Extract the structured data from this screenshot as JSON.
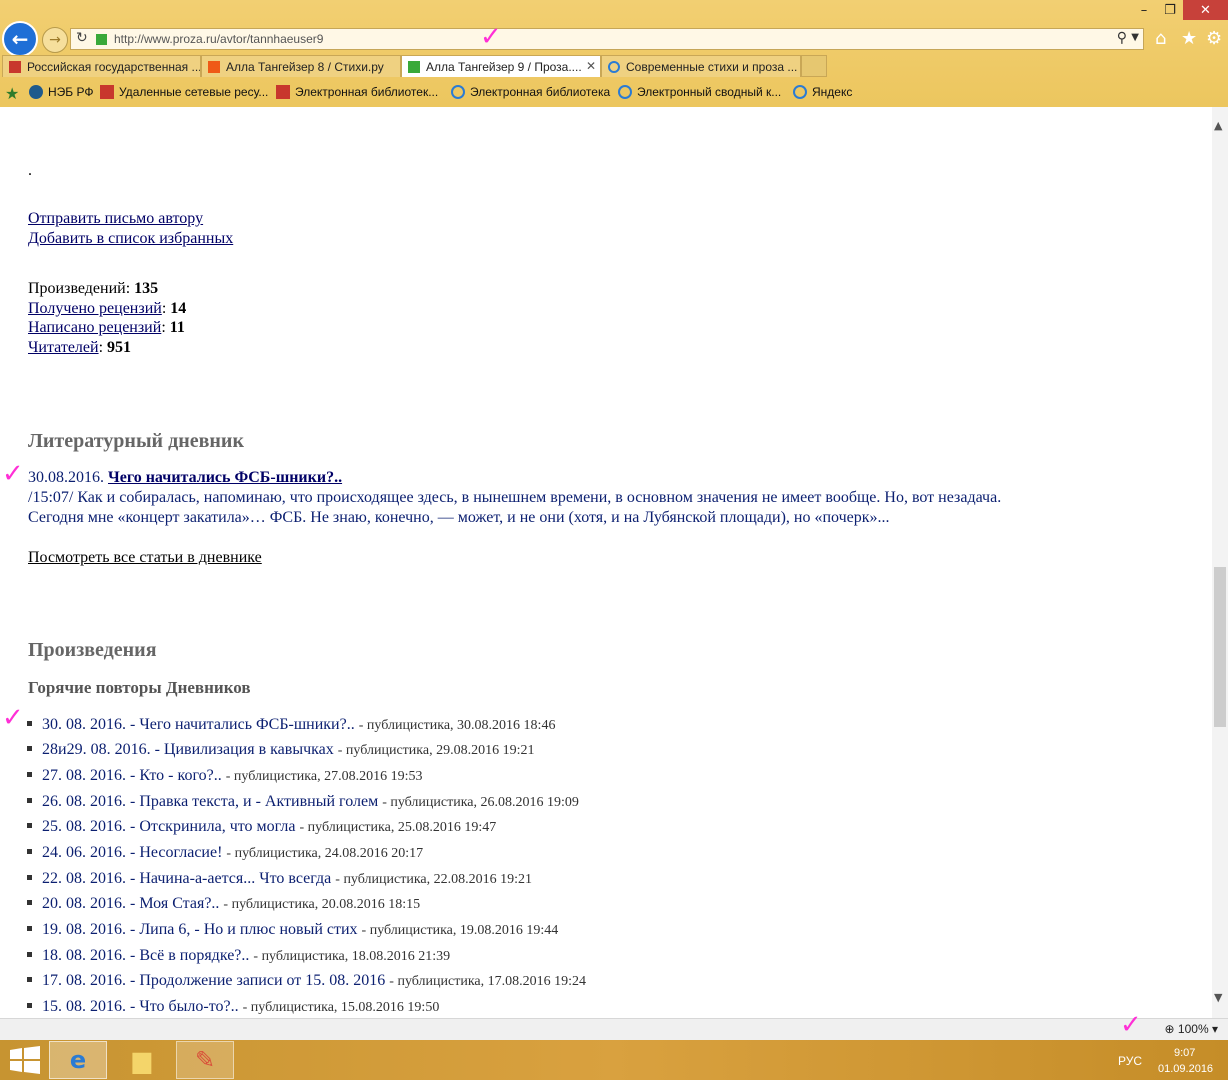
{
  "browser": {
    "url": "http://www.proza.ru/avtor/tannhaeuser9",
    "tabs": [
      {
        "label": "Российская государственная ...",
        "icon_color": "#c8372d"
      },
      {
        "label": "Алла Тангейзер 8 / Стихи.ру",
        "icon_color": "#ef5a17"
      },
      {
        "label": "Алла Тангейзер 9 / Проза....",
        "icon_color": "#3aa93a"
      },
      {
        "label": "Современные стихи и проза ...",
        "icon_color": "#2a7bd4"
      }
    ],
    "favorites": [
      {
        "label": "НЭБ РФ"
      },
      {
        "label": "Удаленные сетевые ресу..."
      },
      {
        "label": "Электронная библиотек..."
      },
      {
        "label": "Электронная библиотека"
      },
      {
        "label": "Электронный сводный к..."
      },
      {
        "label": "Яндекс"
      }
    ],
    "zoom": "100%"
  },
  "page": {
    "dot": ".",
    "send_letter": "Отправить письмо автору",
    "add_favorites": "Добавить в список избранных",
    "stats": {
      "works_label": "Произведений",
      "works_value": "135",
      "received_label": "Получено рецензий",
      "received_value": "14",
      "written_label": "Написано рецензий",
      "written_value": "11",
      "readers_label": "Читателей",
      "readers_value": "951"
    },
    "diary": {
      "heading": "Литературный дневник",
      "entry_date": "30.08.2016.",
      "entry_title": "Чего начитались ФСБ-шники?..",
      "excerpt_line1": "/15:07/ Как и собиралась, напоминаю, что происходящее здесь, в нынешнем времени, в основном значения не имеет вообще. Но, вот незадача.",
      "excerpt_line2": "Сегодня мне «концерт закатила»… ФСБ. Не знаю, конечно, — может, и не они (хотя, и на Лубянской площади), но «почерк»...",
      "view_all": "Посмотреть все статьи в дневнике"
    },
    "works_heading": "Произведения",
    "works_subheading": "Горячие повторы Дневников",
    "works": [
      {
        "title": "30. 08. 2016. - Чего начитались ФСБ-шники?..",
        "meta": "- публицистика, 30.08.2016 18:46"
      },
      {
        "title": "28и29. 08. 2016. - Цивилизация в кавычках",
        "meta": "- публицистика, 29.08.2016 19:21"
      },
      {
        "title": "27. 08. 2016. - Кто - кого?..",
        "meta": "- публицистика, 27.08.2016 19:53"
      },
      {
        "title": "26. 08. 2016. - Правка текста, и - Активный голем",
        "meta": "- публицистика, 26.08.2016 19:09"
      },
      {
        "title": "25. 08. 2016. - Отскринила, что могла",
        "meta": "- публицистика, 25.08.2016 19:47"
      },
      {
        "title": "24. 06. 2016. - Несогласие!",
        "meta": "- публицистика, 24.08.2016 20:17"
      },
      {
        "title": "22. 08. 2016. - Начина-а-ается... Что всегда",
        "meta": "- публицистика, 22.08.2016 19:21"
      },
      {
        "title": "20. 08. 2016. - Моя Стая?..",
        "meta": "- публицистика, 20.08.2016 18:15"
      },
      {
        "title": "19. 08. 2016. - Липа 6, - Но и плюс новый стих",
        "meta": "- публицистика, 19.08.2016 19:44"
      },
      {
        "title": "18. 08. 2016. - Всё в порядке?..",
        "meta": "- публицистика, 18.08.2016 21:39"
      },
      {
        "title": "17. 08. 2016. - Продолжение записи от 15. 08. 2016",
        "meta": "- публицистика, 17.08.2016 19:24"
      },
      {
        "title": "15. 08. 2016. - Что было-то?..",
        "meta": "- публицистика, 15.08.2016 19:50"
      }
    ]
  },
  "taskbar": {
    "lang": "РУС",
    "time": "9:07",
    "date": "01.09.2016"
  }
}
